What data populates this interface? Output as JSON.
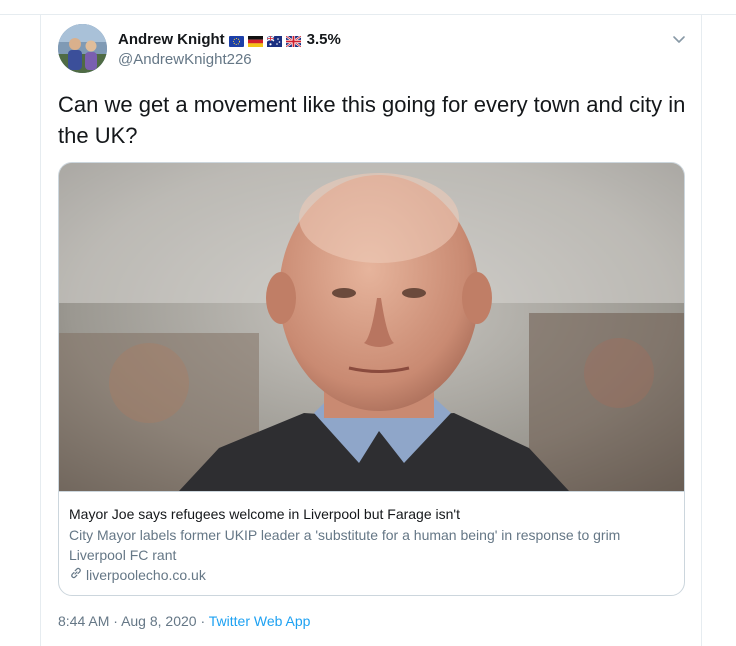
{
  "tweet": {
    "author": {
      "display_name": "Andrew Knight",
      "name_suffix": "3.5%",
      "handle": "@AndrewKnight226",
      "flags": [
        "eu-flag-icon",
        "germany-flag-icon",
        "australia-flag-icon",
        "uk-flag-icon"
      ]
    },
    "text": "Can we get a movement like this going for every town and city in the UK?",
    "card": {
      "title": "Mayor Joe says refugees welcome in Liverpool but Farage isn't",
      "description": "City Mayor labels former UKIP leader a 'substitute for a human being' in response to grim Liverpool FC rant",
      "domain": "liverpoolecho.co.uk"
    },
    "time": "8:44 AM",
    "separator": "·",
    "date": "Aug 8, 2020",
    "app": "Twitter Web App"
  },
  "colors": {
    "text_primary": "#14171a",
    "text_secondary": "#657786",
    "link": "#1da1f2",
    "border": "#ccd6dd"
  }
}
